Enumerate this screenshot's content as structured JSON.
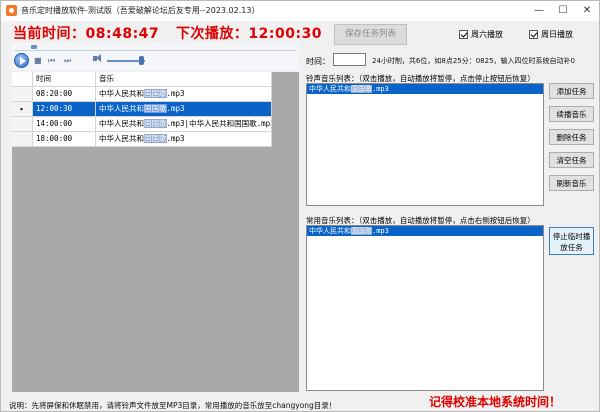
{
  "window": {
    "title": "音乐定时播放软件-测试版（吾爱破解论坛后友专用--2023.02.13）",
    "minimize_icon": "—",
    "maximize_icon": "☐",
    "close_icon": "✕"
  },
  "clock": {
    "current_label": "当前时间：",
    "current_time": "08:48:47",
    "next_label": "下次播放：",
    "next_time": "12:00:30"
  },
  "header": {
    "save_button": "保存任务列表",
    "weekday_saturday": "周六播放",
    "weekday_sunday": "周日播放"
  },
  "player": {
    "stop_icon": "■",
    "prev_icon": "⏮",
    "next_icon": "⏭",
    "seek_fraction": 0.06,
    "volume_fraction": 0.9
  },
  "task_table": {
    "columns": [
      "时间",
      "音乐"
    ],
    "rows": [
      {
        "time": "08:20:00",
        "music_pre": "中华人民共和",
        "music_hl": "国国歌",
        "music_post": ".mp3",
        "selected": false
      },
      {
        "time": "12:00:30",
        "music_pre": "中华人民共和",
        "music_hl": "国国歌",
        "music_post": ".mp3",
        "selected": true
      },
      {
        "time": "14:00:00",
        "music_pre": "中华人民共和",
        "music_hl": "国国歌",
        "music_post": ".mp3|中华人民共和国国歌.mp3",
        "selected": false
      },
      {
        "time": "18:00:00",
        "music_pre": "中华人民共和",
        "music_hl": "国国歌",
        "music_post": ".mp3",
        "selected": false
      }
    ]
  },
  "time_entry": {
    "label": "时间：",
    "value": "",
    "hint": "24小时制，共6位，如8点25分：0825，输入四位时系统自动补0"
  },
  "ring_list": {
    "label": "铃声音乐列表：（双击播放，自动播放将暂停，点击停止按钮后恢复）",
    "items": [
      {
        "pre": "中华人民共和",
        "hl": "国国歌",
        "post": ".mp3"
      }
    ]
  },
  "side_buttons": {
    "add": "添加任务",
    "continue": "续播音乐",
    "delete": "删除任务",
    "clear": "清空任务",
    "refresh": "刷新音乐",
    "stop_current": "停止临时播放任务"
  },
  "common_list": {
    "label": "常用音乐列表：（双击播放，自动播放将暂停，点击右侧按钮后恢复）",
    "items": [
      {
        "pre": "中华人民共和",
        "hl": "国国歌",
        "post": ".mp3"
      }
    ]
  },
  "status": {
    "text": "说明：先将屏保和休眠禁用，请将铃声文件放至MP3目录，常用播放的音乐放至changyong目录！",
    "sync_note": "记得校准本地系统时间！"
  },
  "colors": {
    "clock_red": "#e00000",
    "selection_blue": "#0a64c8",
    "grid_background": "#a9a9a9"
  }
}
